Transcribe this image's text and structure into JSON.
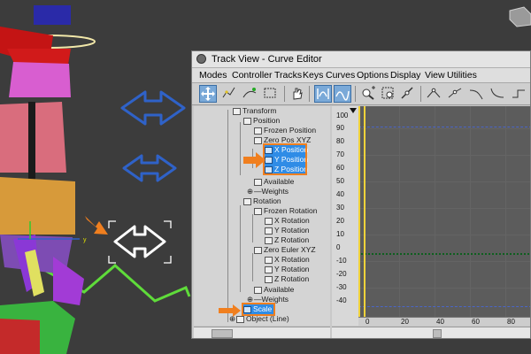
{
  "window": {
    "title": "Track View - Curve Editor"
  },
  "menubar": [
    "Modes",
    "Controller",
    "Tracks",
    "Keys",
    "Curves",
    "Options",
    "Display",
    "View",
    "Utilities"
  ],
  "toolbar": [
    "move-keys",
    "draw-curves",
    "add-keys",
    "region",
    "pan",
    "frame-horizontal",
    "frame-value",
    "zoom",
    "zoom-region",
    "isolate",
    "tangent-auto",
    "tangent-custom",
    "tangent-fast",
    "tangent-slow"
  ],
  "tree": {
    "transform": "Transform",
    "position": "Position",
    "frozen_position": "Frozen Position",
    "zero_pos_xyz": "Zero Pos XYZ",
    "x_position": "X Position",
    "y_position": "Y Position",
    "z_position": "Z Position",
    "available_1": "Available",
    "weights_1": "Weights",
    "rotation": "Rotation",
    "frozen_rotation": "Frozen Rotation",
    "x_rotation_1": "X Rotation",
    "y_rotation_1": "Y Rotation",
    "z_rotation_1": "Z Rotation",
    "zero_euler_xyz": "Zero Euler XYZ",
    "x_rotation_2": "X Rotation",
    "y_rotation_2": "Y Rotation",
    "z_rotation_2": "Z Rotation",
    "available_2": "Available",
    "weights_2": "Weights",
    "scale": "Scale",
    "object": "Object (Line)"
  },
  "graph": {
    "y_ticks": [
      "100",
      "90",
      "80",
      "70",
      "60",
      "50",
      "40",
      "30",
      "20",
      "10",
      "0",
      "-10",
      "-20",
      "-30",
      "-40"
    ],
    "x_ticks": [
      "0",
      "20",
      "40",
      "60",
      "80"
    ]
  },
  "colors": {
    "highlight": "#2f8ce6",
    "callout": "#f07f1f",
    "arrow_blue": "#2f62c8",
    "curve_yellow": "#f0d23a"
  }
}
